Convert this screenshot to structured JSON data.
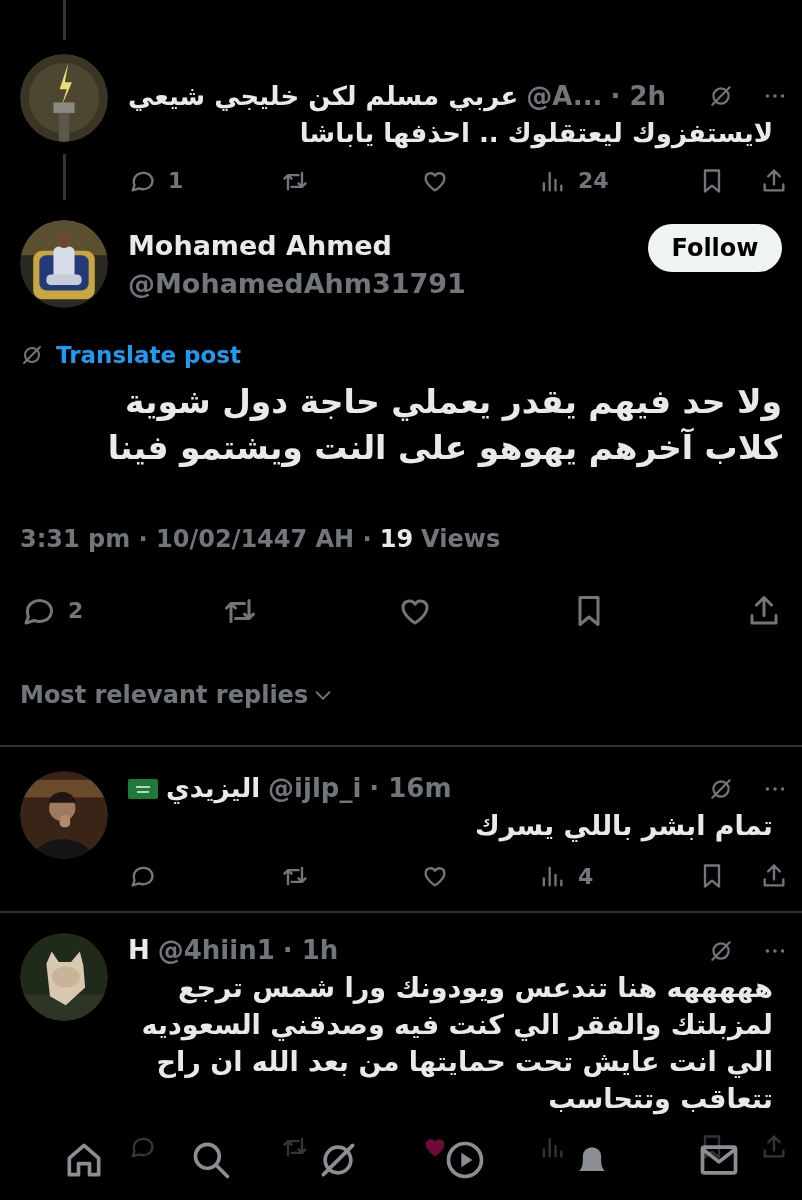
{
  "thread_parent": {
    "name": "عربي مسلم لكن خليجي شيعي",
    "handle": "@A...",
    "time": "· 2h",
    "text": "لايستفزوك ليعتقلوك .. احذفها ياباشا",
    "reply_count": "1",
    "views": "24",
    "liked": false
  },
  "post": {
    "name": "Mohamed Ahmed",
    "handle": "@MohamedAhm31791",
    "follow_label": "Follow",
    "translate_label": "Translate post",
    "text": "ولا حد فيهم يقدر يعملي حاجة دول شوية كلاب آخرهم يهوهو على النت ويشتمو فينا",
    "timestamp": "3:31 pm · 10/02/1447 AH ·",
    "views_count": "19",
    "views_label": "Views",
    "reply_count": "2",
    "liked": false
  },
  "replies_sort": {
    "label": "Most relevant replies"
  },
  "replies": [
    {
      "name": "اليزيدي",
      "has_flag": true,
      "handle": "@ijlp_i",
      "time": "· 16m",
      "text": "تمام ابشر باللي يسرك",
      "views": "4",
      "liked": false
    },
    {
      "name": "H",
      "has_flag": false,
      "handle": "@4hiin1",
      "time": "· 1h",
      "text": "هههههه هنا تندعس ويودونك ورا شمس ترجع لمزبلتك والفقر الي كنت فيه وصدقني السعوديه الي انت عايش تحت حمايتها من بعد الله ان راح تتعاقب وتتحاسب",
      "liked": true
    }
  ]
}
